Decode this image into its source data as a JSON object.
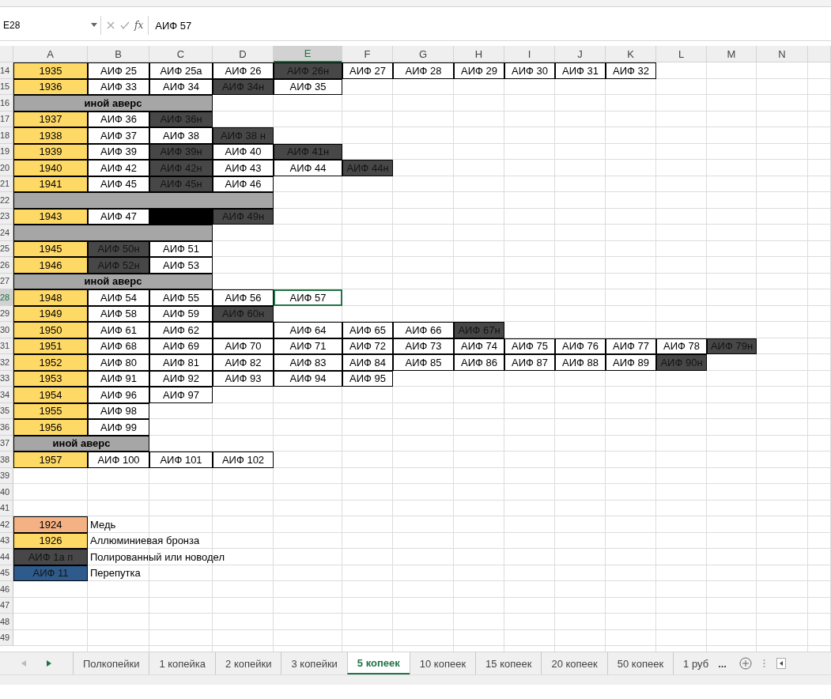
{
  "formula_bar": {
    "name_box": "E28",
    "fx_label": "fx",
    "value": "АИФ 57"
  },
  "columns": [
    "A",
    "B",
    "C",
    "D",
    "E",
    "F",
    "G",
    "H",
    "I",
    "J",
    "K",
    "L",
    "M",
    "N"
  ],
  "rows": [
    {
      "number": "14",
      "cells": [
        {
          "kind": "year",
          "text": "1935",
          "selected": false
        },
        {
          "kind": "coin",
          "text": "АИФ 25",
          "selected": false
        },
        {
          "kind": "coin",
          "text": "АИФ 25а",
          "selected": false
        },
        {
          "kind": "coin",
          "text": "АИФ 26",
          "selected": false
        },
        {
          "kind": "variant",
          "text": "АИФ 26н",
          "selected": false
        },
        {
          "kind": "coin",
          "text": "АИФ 27",
          "selected": false
        },
        {
          "kind": "coin",
          "text": "АИФ 28",
          "selected": false
        },
        {
          "kind": "coin",
          "text": "АИФ 29",
          "selected": false
        },
        {
          "kind": "coin",
          "text": "АИФ 30",
          "selected": false
        },
        {
          "kind": "coin",
          "text": "АИФ 31",
          "selected": false
        },
        {
          "kind": "coin",
          "text": "АИФ 32",
          "selected": false
        }
      ]
    },
    {
      "number": "15",
      "cells": [
        {
          "kind": "year",
          "text": "1936",
          "selected": false
        },
        {
          "kind": "coin",
          "text": "АИФ 33",
          "selected": false
        },
        {
          "kind": "coin",
          "text": "АИФ 34",
          "selected": false
        },
        {
          "kind": "variant",
          "text": "АИФ 34н",
          "selected": false
        },
        {
          "kind": "coin",
          "text": "АИФ 35",
          "selected": false
        }
      ]
    },
    {
      "number": "16",
      "cells": [
        {
          "kind": "band",
          "text": "иной аверс",
          "selected": false
        },
        {
          "kind": "band"
        },
        {
          "kind": "band"
        }
      ]
    },
    {
      "number": "17",
      "cells": [
        {
          "kind": "year",
          "text": "1937",
          "selected": false
        },
        {
          "kind": "coin",
          "text": "АИФ 36",
          "selected": false
        },
        {
          "kind": "variant",
          "text": "АИФ 36н",
          "selected": false
        }
      ]
    },
    {
      "number": "18",
      "cells": [
        {
          "kind": "year",
          "text": "1938",
          "selected": false
        },
        {
          "kind": "coin",
          "text": "АИФ 37",
          "selected": false
        },
        {
          "kind": "coin",
          "text": "АИФ 38",
          "selected": false
        },
        {
          "kind": "variant",
          "text": "АИФ 38 н",
          "selected": false
        }
      ]
    },
    {
      "number": "19",
      "cells": [
        {
          "kind": "year",
          "text": "1939",
          "selected": false
        },
        {
          "kind": "coin",
          "text": "АИФ 39",
          "selected": false
        },
        {
          "kind": "variant",
          "text": "АИФ 39н",
          "selected": false
        },
        {
          "kind": "coin",
          "text": "АИФ 40",
          "selected": false
        },
        {
          "kind": "variant",
          "text": "АИФ 41н",
          "selected": false
        }
      ]
    },
    {
      "number": "20",
      "cells": [
        {
          "kind": "year",
          "text": "1940",
          "selected": false
        },
        {
          "kind": "coin",
          "text": "АИФ 42",
          "selected": false
        },
        {
          "kind": "variant",
          "text": "АИФ 42н",
          "selected": false
        },
        {
          "kind": "coin",
          "text": "АИФ 43",
          "selected": false
        },
        {
          "kind": "coin",
          "text": "АИФ 44",
          "selected": false
        },
        {
          "kind": "variant",
          "text": "АИФ 44н",
          "selected": false
        }
      ]
    },
    {
      "number": "21",
      "cells": [
        {
          "kind": "year",
          "text": "1941",
          "selected": false
        },
        {
          "kind": "coin",
          "text": "АИФ 45",
          "selected": false
        },
        {
          "kind": "variant",
          "text": "АИФ 45н",
          "selected": false
        },
        {
          "kind": "coin",
          "text": "АИФ 46",
          "selected": false
        }
      ]
    },
    {
      "number": "22",
      "cells": [
        {
          "kind": "band",
          "selected": false
        },
        {
          "kind": "band"
        },
        {
          "kind": "band"
        },
        {
          "kind": "band"
        }
      ]
    },
    {
      "number": "23",
      "cells": [
        {
          "kind": "year",
          "text": "1943",
          "selected": false
        },
        {
          "kind": "coin",
          "text": "АИФ 47",
          "selected": false
        },
        {
          "kind": "black",
          "selected": false
        },
        {
          "kind": "variant",
          "text": "АИФ 49н",
          "selected": false
        }
      ]
    },
    {
      "number": "24",
      "cells": [
        {
          "kind": "band",
          "selected": false
        },
        {
          "kind": "band"
        },
        {
          "kind": "band"
        }
      ]
    },
    {
      "number": "25",
      "cells": [
        {
          "kind": "year",
          "text": "1945",
          "selected": false
        },
        {
          "kind": "variant",
          "text": "АИФ 50н",
          "selected": false
        },
        {
          "kind": "coin",
          "text": "АИФ 51",
          "selected": false
        }
      ]
    },
    {
      "number": "26",
      "cells": [
        {
          "kind": "year",
          "text": "1946",
          "selected": false
        },
        {
          "kind": "variant",
          "text": "АИФ 52н",
          "selected": false
        },
        {
          "kind": "coin",
          "text": "АИФ 53",
          "selected": false
        }
      ]
    },
    {
      "number": "27",
      "cells": [
        {
          "kind": "band",
          "text": "иной аверс",
          "selected": false
        },
        {
          "kind": "band"
        },
        {
          "kind": "band"
        }
      ]
    },
    {
      "number": "28",
      "cells": [
        {
          "kind": "year",
          "text": "1948",
          "selected": false
        },
        {
          "kind": "coin",
          "text": "АИФ 54",
          "selected": false
        },
        {
          "kind": "coin",
          "text": "АИФ 55",
          "selected": false
        },
        {
          "kind": "coin",
          "text": "АИФ 56",
          "selected": false
        },
        {
          "kind": "coin",
          "text": "АИФ 57",
          "selected": true
        }
      ]
    },
    {
      "number": "29",
      "cells": [
        {
          "kind": "year",
          "text": "1949",
          "selected": false
        },
        {
          "kind": "coin",
          "text": "АИФ 58",
          "selected": false
        },
        {
          "kind": "coin",
          "text": "АИФ 59",
          "selected": false
        },
        {
          "kind": "variant",
          "text": "АИФ 60н",
          "selected": false
        }
      ]
    },
    {
      "number": "30",
      "cells": [
        {
          "kind": "year",
          "text": "1950",
          "selected": false
        },
        {
          "kind": "coin",
          "text": "АИФ 61",
          "selected": false
        },
        {
          "kind": "coin",
          "text": "АИФ 62",
          "selected": false
        },
        {
          "kind": "coin",
          "selected": false
        },
        {
          "kind": "coin",
          "text": "АИФ 64",
          "selected": false
        },
        {
          "kind": "coin",
          "text": "АИФ 65",
          "selected": false
        },
        {
          "kind": "coin",
          "text": "АИФ 66",
          "selected": false
        },
        {
          "kind": "variant",
          "text": "АИФ 67н",
          "selected": false
        }
      ]
    },
    {
      "number": "31",
      "cells": [
        {
          "kind": "year",
          "text": "1951",
          "selected": false
        },
        {
          "kind": "coin",
          "text": "АИФ 68",
          "selected": false
        },
        {
          "kind": "coin",
          "text": "АИФ 69",
          "selected": false
        },
        {
          "kind": "coin",
          "text": "АИФ 70",
          "selected": false
        },
        {
          "kind": "coin",
          "text": "АИФ 71",
          "selected": false
        },
        {
          "kind": "coin",
          "text": "АИФ 72",
          "selected": false
        },
        {
          "kind": "coin",
          "text": "АИФ 73",
          "selected": false
        },
        {
          "kind": "coin",
          "text": "АИФ 74",
          "selected": false
        },
        {
          "kind": "coin",
          "text": "АИФ 75",
          "selected": false
        },
        {
          "kind": "coin",
          "text": "АИФ 76",
          "selected": false
        },
        {
          "kind": "coin",
          "text": "АИФ 77",
          "selected": false
        },
        {
          "kind": "coin",
          "text": "АИФ 78",
          "selected": false
        },
        {
          "kind": "variant",
          "text": "АИФ 79н",
          "selected": false
        }
      ]
    },
    {
      "number": "32",
      "cells": [
        {
          "kind": "year",
          "text": "1952",
          "selected": false
        },
        {
          "kind": "coin",
          "text": "АИФ 80",
          "selected": false
        },
        {
          "kind": "coin",
          "text": "АИФ 81",
          "selected": false
        },
        {
          "kind": "coin",
          "text": "АИФ 82",
          "selected": false
        },
        {
          "kind": "coin",
          "text": "АИФ 83",
          "selected": false
        },
        {
          "kind": "coin",
          "text": "АИФ 84",
          "selected": false
        },
        {
          "kind": "coin",
          "text": "АИФ 85",
          "selected": false
        },
        {
          "kind": "coin",
          "text": "АИФ 86",
          "selected": false
        },
        {
          "kind": "coin",
          "text": "АИФ 87",
          "selected": false
        },
        {
          "kind": "coin",
          "text": "АИФ 88",
          "selected": false
        },
        {
          "kind": "coin",
          "text": "АИФ 89",
          "selected": false
        },
        {
          "kind": "variant",
          "text": "АИФ 90н",
          "selected": false
        }
      ]
    },
    {
      "number": "33",
      "cells": [
        {
          "kind": "year",
          "text": "1953",
          "selected": false
        },
        {
          "kind": "coin",
          "text": "АИФ 91",
          "selected": false
        },
        {
          "kind": "coin",
          "text": "АИФ 92",
          "selected": false
        },
        {
          "kind": "coin",
          "text": "АИФ 93",
          "selected": false
        },
        {
          "kind": "coin",
          "text": "АИФ 94",
          "selected": false
        },
        {
          "kind": "coin",
          "text": "АИФ 95",
          "selected": false
        }
      ]
    },
    {
      "number": "34",
      "cells": [
        {
          "kind": "year",
          "text": "1954",
          "selected": false
        },
        {
          "kind": "coin",
          "text": "АИФ 96",
          "selected": false
        },
        {
          "kind": "coin",
          "text": "АИФ 97",
          "selected": false
        }
      ]
    },
    {
      "number": "35",
      "cells": [
        {
          "kind": "year",
          "text": "1955",
          "selected": false
        },
        {
          "kind": "coin",
          "text": "АИФ 98",
          "selected": false
        }
      ]
    },
    {
      "number": "36",
      "cells": [
        {
          "kind": "year",
          "text": "1956",
          "selected": false
        },
        {
          "kind": "coin",
          "text": "АИФ 99",
          "selected": false
        }
      ]
    },
    {
      "number": "37",
      "cells": [
        {
          "kind": "band",
          "text": "иной аверс",
          "selected": false
        },
        {
          "kind": "band"
        }
      ]
    },
    {
      "number": "38",
      "cells": [
        {
          "kind": "year",
          "text": "1957",
          "selected": false
        },
        {
          "kind": "coin",
          "text": "АИФ 100",
          "selected": false
        },
        {
          "kind": "coin",
          "text": "АИФ 101",
          "selected": false
        },
        {
          "kind": "coin",
          "text": "АИФ 102",
          "selected": false
        }
      ]
    },
    {
      "number": "39",
      "cells": []
    },
    {
      "number": "40",
      "cells": []
    },
    {
      "number": "41",
      "cells": []
    },
    {
      "number": "42",
      "cells": [
        {
          "kind": "copper",
          "text": "1924",
          "selected": false
        },
        {
          "kind": "label",
          "text": "Медь"
        }
      ]
    },
    {
      "number": "43",
      "cells": [
        {
          "kind": "year",
          "text": "1926",
          "selected": false
        },
        {
          "kind": "label",
          "text": "Аллюминиевая бронза"
        }
      ]
    },
    {
      "number": "44",
      "cells": [
        {
          "kind": "variant",
          "text": "АИФ 1а п",
          "selected": false
        },
        {
          "kind": "label",
          "text": "Полированный или новодел"
        }
      ]
    },
    {
      "number": "45",
      "cells": [
        {
          "kind": "blue",
          "text": "АИФ 11",
          "selected": false
        },
        {
          "kind": "label",
          "text": "Перепутка"
        }
      ]
    },
    {
      "number": "46",
      "cells": []
    },
    {
      "number": "47",
      "cells": []
    },
    {
      "number": "48",
      "cells": []
    },
    {
      "number": "49",
      "cells": []
    }
  ],
  "sheet_tabs": [
    {
      "label": "Полкопейки",
      "selected": false
    },
    {
      "label": "1 копейка",
      "selected": false
    },
    {
      "label": "2 копейки",
      "selected": false
    },
    {
      "label": "3 копейки",
      "selected": false
    },
    {
      "label": "5 копеек",
      "selected": true
    },
    {
      "label": "10 копеек",
      "selected": false
    },
    {
      "label": "15 копеек",
      "selected": false
    },
    {
      "label": "20 копеек",
      "selected": false
    },
    {
      "label": "50 копеек",
      "selected": false
    },
    {
      "label": "1 руб",
      "selected": false
    }
  ],
  "tabs_overflow": "..."
}
